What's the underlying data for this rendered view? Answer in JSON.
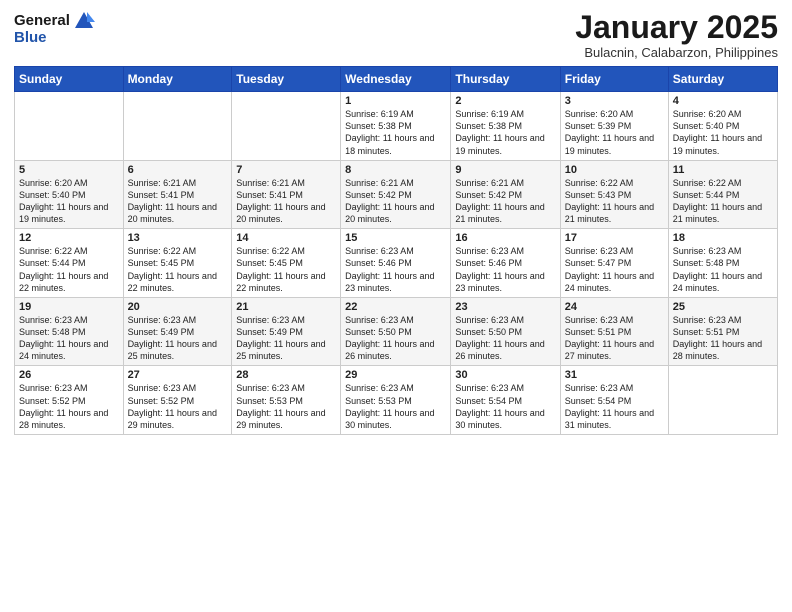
{
  "header": {
    "logo_general": "General",
    "logo_blue": "Blue",
    "month_title": "January 2025",
    "location": "Bulacnin, Calabarzon, Philippines"
  },
  "weekdays": [
    "Sunday",
    "Monday",
    "Tuesday",
    "Wednesday",
    "Thursday",
    "Friday",
    "Saturday"
  ],
  "weeks": [
    [
      {
        "day": "",
        "info": ""
      },
      {
        "day": "",
        "info": ""
      },
      {
        "day": "",
        "info": ""
      },
      {
        "day": "1",
        "info": "Sunrise: 6:19 AM\nSunset: 5:38 PM\nDaylight: 11 hours and 18 minutes."
      },
      {
        "day": "2",
        "info": "Sunrise: 6:19 AM\nSunset: 5:38 PM\nDaylight: 11 hours and 19 minutes."
      },
      {
        "day": "3",
        "info": "Sunrise: 6:20 AM\nSunset: 5:39 PM\nDaylight: 11 hours and 19 minutes."
      },
      {
        "day": "4",
        "info": "Sunrise: 6:20 AM\nSunset: 5:40 PM\nDaylight: 11 hours and 19 minutes."
      }
    ],
    [
      {
        "day": "5",
        "info": "Sunrise: 6:20 AM\nSunset: 5:40 PM\nDaylight: 11 hours and 19 minutes."
      },
      {
        "day": "6",
        "info": "Sunrise: 6:21 AM\nSunset: 5:41 PM\nDaylight: 11 hours and 20 minutes."
      },
      {
        "day": "7",
        "info": "Sunrise: 6:21 AM\nSunset: 5:41 PM\nDaylight: 11 hours and 20 minutes."
      },
      {
        "day": "8",
        "info": "Sunrise: 6:21 AM\nSunset: 5:42 PM\nDaylight: 11 hours and 20 minutes."
      },
      {
        "day": "9",
        "info": "Sunrise: 6:21 AM\nSunset: 5:42 PM\nDaylight: 11 hours and 21 minutes."
      },
      {
        "day": "10",
        "info": "Sunrise: 6:22 AM\nSunset: 5:43 PM\nDaylight: 11 hours and 21 minutes."
      },
      {
        "day": "11",
        "info": "Sunrise: 6:22 AM\nSunset: 5:44 PM\nDaylight: 11 hours and 21 minutes."
      }
    ],
    [
      {
        "day": "12",
        "info": "Sunrise: 6:22 AM\nSunset: 5:44 PM\nDaylight: 11 hours and 22 minutes."
      },
      {
        "day": "13",
        "info": "Sunrise: 6:22 AM\nSunset: 5:45 PM\nDaylight: 11 hours and 22 minutes."
      },
      {
        "day": "14",
        "info": "Sunrise: 6:22 AM\nSunset: 5:45 PM\nDaylight: 11 hours and 22 minutes."
      },
      {
        "day": "15",
        "info": "Sunrise: 6:23 AM\nSunset: 5:46 PM\nDaylight: 11 hours and 23 minutes."
      },
      {
        "day": "16",
        "info": "Sunrise: 6:23 AM\nSunset: 5:46 PM\nDaylight: 11 hours and 23 minutes."
      },
      {
        "day": "17",
        "info": "Sunrise: 6:23 AM\nSunset: 5:47 PM\nDaylight: 11 hours and 24 minutes."
      },
      {
        "day": "18",
        "info": "Sunrise: 6:23 AM\nSunset: 5:48 PM\nDaylight: 11 hours and 24 minutes."
      }
    ],
    [
      {
        "day": "19",
        "info": "Sunrise: 6:23 AM\nSunset: 5:48 PM\nDaylight: 11 hours and 24 minutes."
      },
      {
        "day": "20",
        "info": "Sunrise: 6:23 AM\nSunset: 5:49 PM\nDaylight: 11 hours and 25 minutes."
      },
      {
        "day": "21",
        "info": "Sunrise: 6:23 AM\nSunset: 5:49 PM\nDaylight: 11 hours and 25 minutes."
      },
      {
        "day": "22",
        "info": "Sunrise: 6:23 AM\nSunset: 5:50 PM\nDaylight: 11 hours and 26 minutes."
      },
      {
        "day": "23",
        "info": "Sunrise: 6:23 AM\nSunset: 5:50 PM\nDaylight: 11 hours and 26 minutes."
      },
      {
        "day": "24",
        "info": "Sunrise: 6:23 AM\nSunset: 5:51 PM\nDaylight: 11 hours and 27 minutes."
      },
      {
        "day": "25",
        "info": "Sunrise: 6:23 AM\nSunset: 5:51 PM\nDaylight: 11 hours and 28 minutes."
      }
    ],
    [
      {
        "day": "26",
        "info": "Sunrise: 6:23 AM\nSunset: 5:52 PM\nDaylight: 11 hours and 28 minutes."
      },
      {
        "day": "27",
        "info": "Sunrise: 6:23 AM\nSunset: 5:52 PM\nDaylight: 11 hours and 29 minutes."
      },
      {
        "day": "28",
        "info": "Sunrise: 6:23 AM\nSunset: 5:53 PM\nDaylight: 11 hours and 29 minutes."
      },
      {
        "day": "29",
        "info": "Sunrise: 6:23 AM\nSunset: 5:53 PM\nDaylight: 11 hours and 30 minutes."
      },
      {
        "day": "30",
        "info": "Sunrise: 6:23 AM\nSunset: 5:54 PM\nDaylight: 11 hours and 30 minutes."
      },
      {
        "day": "31",
        "info": "Sunrise: 6:23 AM\nSunset: 5:54 PM\nDaylight: 11 hours and 31 minutes."
      },
      {
        "day": "",
        "info": ""
      }
    ]
  ]
}
